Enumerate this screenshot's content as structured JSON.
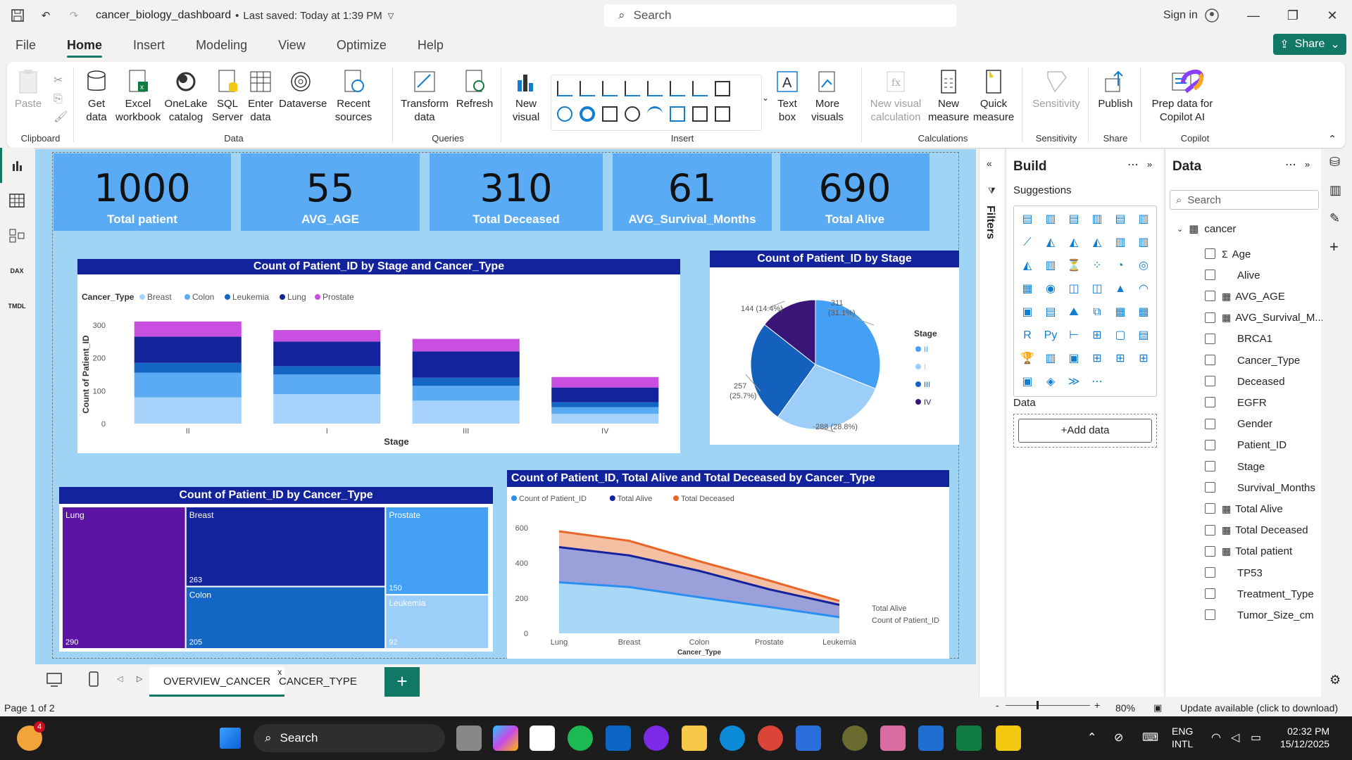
{
  "titlebar": {
    "file_name": "cancer_biology_dashboard",
    "saved": "Last saved: Today at 1:39 PM",
    "search_placeholder": "Search",
    "sign_in": "Sign in"
  },
  "menu": [
    "File",
    "Home",
    "Insert",
    "Modeling",
    "View",
    "Optimize",
    "Help"
  ],
  "share_label": "Share",
  "ribbon": {
    "clipboard": {
      "paste": "Paste",
      "group": "Clipboard"
    },
    "data": {
      "get_data": "Get data",
      "excel": "Excel workbook",
      "onelake": "OneLake catalog",
      "sql": "SQL Server",
      "enter": "Enter data",
      "dataverse": "Dataverse",
      "recent": "Recent sources",
      "group": "Data"
    },
    "queries": {
      "transform": "Transform data",
      "refresh": "Refresh",
      "group": "Queries"
    },
    "insert": {
      "new_visual": "New visual",
      "text_box": "Text box",
      "more_visuals": "More visuals",
      "group": "Insert"
    },
    "calculations": {
      "new_visual_calc": "New visual calculation",
      "new_measure": "New measure",
      "quick_measure": "Quick measure",
      "group": "Calculations"
    },
    "sensitivity": {
      "label": "Sensitivity",
      "group": "Sensitivity"
    },
    "share": {
      "publish": "Publish",
      "group": "Share"
    },
    "copilot": {
      "prep": "Prep data for Copilot AI",
      "copilot": "Copilot",
      "group": "Copilot"
    }
  },
  "kpis": [
    {
      "value": "1000",
      "label": "Total patient"
    },
    {
      "value": "55",
      "label": "AVG_AGE"
    },
    {
      "value": "310",
      "label": "Total Deceased"
    },
    {
      "value": "61",
      "label": "AVG_Survival_Months"
    },
    {
      "value": "690",
      "label": "Total Alive"
    }
  ],
  "stacked_chart": {
    "title": "Count of Patient_ID by Stage and Cancer_Type",
    "legend_title": "Cancer_Type",
    "xlabel": "Stage",
    "ylabel": "Count of Patient_ID"
  },
  "pie_chart": {
    "title": "Count of Patient_ID by Stage",
    "legend_title": "Stage"
  },
  "treemap": {
    "title": "Count of Patient_ID by Cancer_Type"
  },
  "area_chart": {
    "title": "Count of Patient_ID, Total Alive and Total Deceased by Cancer_Type",
    "xlabel": "Cancer_Type",
    "end_label1": "Total Alive",
    "end_label2": "Count of Patient_ID"
  },
  "chart_data": [
    {
      "type": "bar",
      "title": "Count of Patient_ID by Stage and Cancer_Type",
      "categories": [
        "II",
        "I",
        "III",
        "IV"
      ],
      "xlabel": "Stage",
      "ylabel": "Count of Patient_ID",
      "ylim": [
        0,
        300
      ],
      "yticks": [
        0,
        100,
        200,
        300
      ],
      "series": [
        {
          "name": "Breast",
          "color": "#a6d2fb",
          "values": [
            80,
            90,
            70,
            30
          ]
        },
        {
          "name": "Colon",
          "color": "#5aabf3",
          "values": [
            75,
            60,
            45,
            20
          ]
        },
        {
          "name": "Leukemia",
          "color": "#1466c4",
          "values": [
            30,
            25,
            25,
            15
          ]
        },
        {
          "name": "Lung",
          "color": "#13239b",
          "values": [
            80,
            75,
            80,
            45
          ]
        },
        {
          "name": "Prostate",
          "color": "#c94fe0",
          "values": [
            46,
            35,
            38,
            32
          ]
        }
      ]
    },
    {
      "type": "pie",
      "title": "Count of Patient_ID by Stage",
      "slices": [
        {
          "name": "II",
          "value": 311,
          "label": "311 (31.1%)",
          "color": "#44a0f5"
        },
        {
          "name": "I",
          "value": 288,
          "label": "288 (28.8%)",
          "color": "#9dcdf9"
        },
        {
          "name": "III",
          "value": 257,
          "label": "257 (25.7%)",
          "color": "#1461bd"
        },
        {
          "name": "IV",
          "value": 144,
          "label": "144 (14.4%)",
          "color": "#3a1578"
        }
      ]
    },
    {
      "type": "heatmap",
      "title": "Count of Patient_ID by Cancer_Type",
      "cells": [
        {
          "name": "Lung",
          "value": 290,
          "color": "#5b14a3"
        },
        {
          "name": "Breast",
          "value": 263,
          "color": "#13239b"
        },
        {
          "name": "Colon",
          "value": 205,
          "color": "#1466c4"
        },
        {
          "name": "Prostate",
          "value": 150,
          "color": "#44a0f5"
        },
        {
          "name": "Leukemia",
          "value": 92,
          "color": "#9dcdf9"
        }
      ]
    },
    {
      "type": "area",
      "title": "Count of Patient_ID, Total Alive and Total Deceased by Cancer_Type",
      "categories": [
        "Lung",
        "Breast",
        "Colon",
        "Prostate",
        "Leukemia"
      ],
      "xlabel": "Cancer_Type",
      "ylim": [
        0,
        600
      ],
      "yticks": [
        0,
        200,
        400,
        600
      ],
      "series": [
        {
          "name": "Count of Patient_ID",
          "color": "#2b8ef0",
          "values": [
            290,
            263,
            205,
            150,
            92
          ]
        },
        {
          "name": "Total Alive",
          "color": "#13239b",
          "values": [
            200,
            180,
            150,
            100,
            70
          ]
        },
        {
          "name": "Total Deceased",
          "color": "#e8662a",
          "values": [
            90,
            83,
            55,
            50,
            22
          ]
        }
      ]
    }
  ],
  "tabs": [
    "OVERVIEW_CANCER",
    "CANCER_TYPE"
  ],
  "filters_label": "Filters",
  "build": {
    "title": "Build",
    "suggestions": "Suggestions",
    "data_label": "Data",
    "add_data": "+Add data"
  },
  "data_pane": {
    "title": "Data",
    "search_placeholder": "Search",
    "table": "cancer",
    "fields": [
      "Age",
      "Alive",
      "AVG_AGE",
      "AVG_Survival_M...",
      "BRCA1",
      "Cancer_Type",
      "Deceased",
      "EGFR",
      "Gender",
      "Patient_ID",
      "Stage",
      "Survival_Months",
      "Total Alive",
      "Total Deceased",
      "Total patient",
      "TP53",
      "Treatment_Type",
      "Tumor_Size_cm"
    ]
  },
  "status": {
    "page": "Page 1 of 2",
    "zoom": "80%",
    "update": "Update available (click to download)"
  },
  "taskbar": {
    "search": "Search",
    "lang1": "ENG",
    "lang2": "INTL",
    "time": "02:32 PM",
    "date": "15/12/2025",
    "badge": "4"
  }
}
